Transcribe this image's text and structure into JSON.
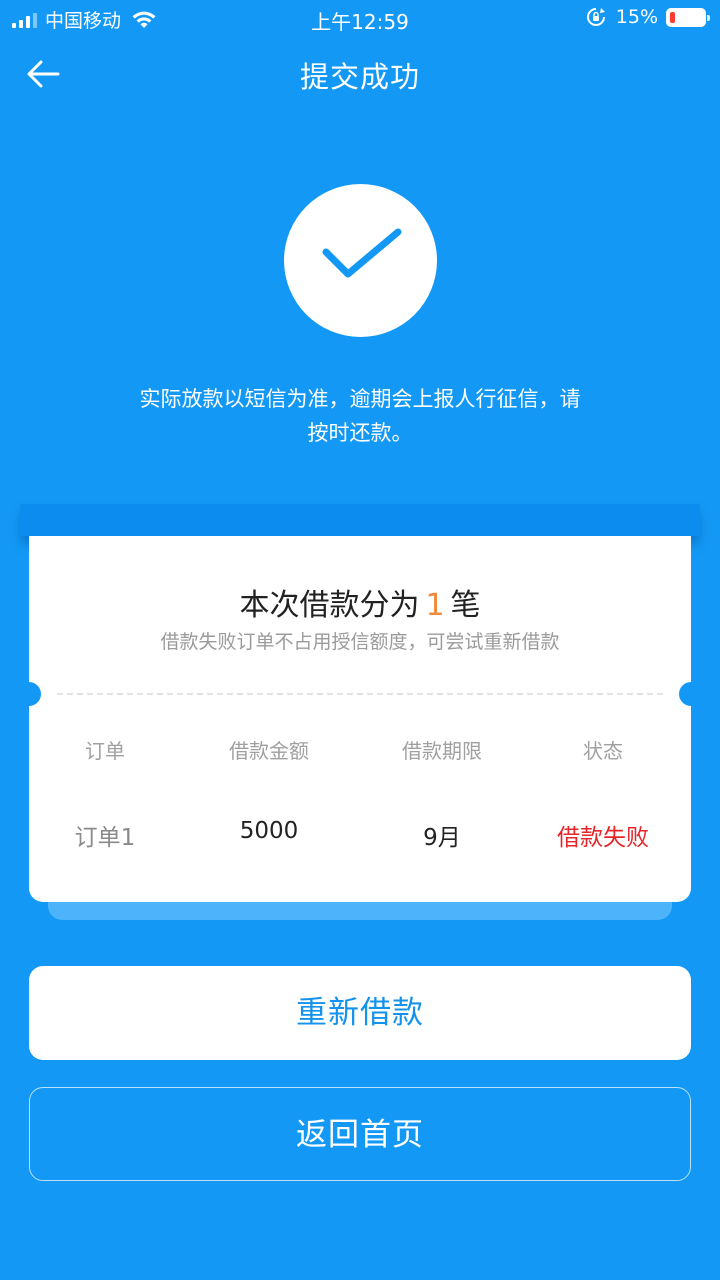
{
  "status_bar": {
    "carrier": "中国移动",
    "time": "上午12:59",
    "battery_percent": "15%",
    "battery_level": 0.15
  },
  "nav": {
    "title": "提交成功"
  },
  "notice": {
    "line1": "实际放款以短信为准，逾期会上报人行征信，请",
    "line2": "按时还款。"
  },
  "card": {
    "title_prefix": "本次借款分为",
    "count": "1",
    "title_suffix": "笔",
    "subtitle": "借款失败订单不占用授信额度，可尝试重新借款",
    "headers": [
      "订单",
      "借款金额",
      "借款期限",
      "状态"
    ],
    "rows": [
      {
        "order": "订单1",
        "amount": "5000",
        "term": "9月",
        "status": "借款失败"
      }
    ]
  },
  "buttons": {
    "retry": "重新借款",
    "home": "返回首页"
  },
  "colors": {
    "background": "#1399f5",
    "accent_orange": "#f08a3c",
    "fail_red": "#e5262b",
    "button_text_blue": "#1592ec"
  }
}
